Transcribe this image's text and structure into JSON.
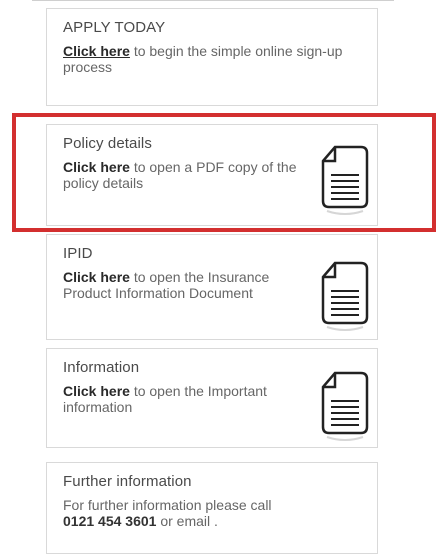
{
  "cards": [
    {
      "title": "APPLY TODAY",
      "link": "Click here",
      "text": "to begin the simple online sign-up process"
    },
    {
      "title": "Policy details",
      "link": "Click here",
      "text": "to open a PDF copy of the policy details",
      "icon": "document-icon"
    },
    {
      "title": "IPID",
      "link": "Click here",
      "text": "to open the Insurance Product Information Document",
      "icon": "document-icon"
    },
    {
      "title": "Information",
      "link": "Click here",
      "text": "to open the Important information",
      "icon": "document-icon"
    },
    {
      "title": "Further information",
      "text_before": "For further information please call",
      "phone": "0121 454 3601",
      "text_after": "or email ."
    }
  ],
  "colors": {
    "highlight_border": "#d32f2f",
    "card_border": "#d9d9d9"
  }
}
